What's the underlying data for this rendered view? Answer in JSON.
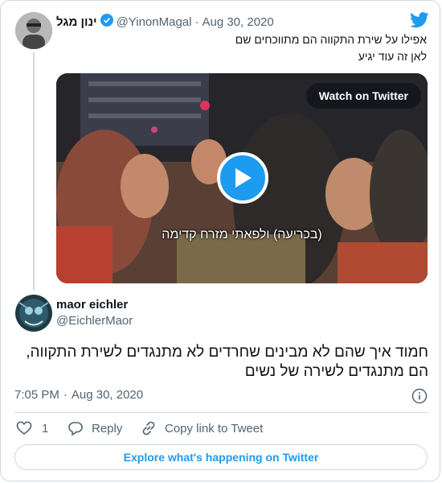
{
  "quoted": {
    "name": "ינון מגל",
    "handle": "@YinonMagal",
    "separator": "·",
    "date": "Aug 30, 2020",
    "text_line1": "אפילו על שירת התקווה הם מתווכחים שם",
    "text_line2": "לאן זה עוד יגיע",
    "media": {
      "watch_label": "Watch on Twitter",
      "subtitle": "(בכריעה) ולפאתי מזרח קדימה"
    }
  },
  "main": {
    "name": "maor eichler",
    "handle": "@EichlerMaor",
    "text": "חמוד איך שהם לא מבינים שחרדים לא מתנגדים לשירת התקווה, הם מתנגדים לשירה של נשים",
    "time": "7:05 PM",
    "separator": "·",
    "date": "Aug 30, 2020"
  },
  "actions": {
    "like_count": "1",
    "reply_label": "Reply",
    "copy_label": "Copy link to Tweet"
  },
  "footer": {
    "explore_label": "Explore what's happening on Twitter"
  },
  "colors": {
    "twitter_blue": "#1d9bf0",
    "verified_blue": "#1d9bf0",
    "border": "#cfd9de",
    "secondary_text": "#536471"
  },
  "icons": [
    "twitter-bird-icon",
    "verified-badge-icon",
    "play-icon",
    "info-icon",
    "heart-icon",
    "reply-icon",
    "link-icon"
  ]
}
